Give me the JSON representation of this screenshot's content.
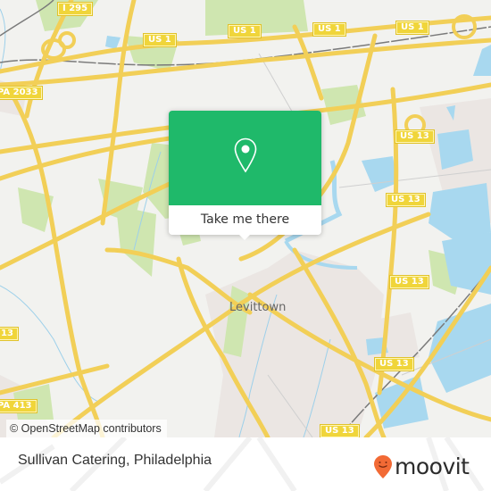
{
  "map": {
    "place_label": "Levittown",
    "shields": [
      {
        "id": "i295",
        "label": "I 295"
      },
      {
        "id": "us1-a",
        "label": "US 1"
      },
      {
        "id": "us1-b",
        "label": "US 1"
      },
      {
        "id": "us1-c",
        "label": "US 1"
      },
      {
        "id": "us1-d",
        "label": "US 1"
      },
      {
        "id": "us1-e",
        "label": "US 1"
      },
      {
        "id": "pa2033",
        "label": "PA 2033"
      },
      {
        "id": "us13-a",
        "label": "US 13"
      },
      {
        "id": "us13-b",
        "label": "US 13"
      },
      {
        "id": "us13-c",
        "label": "US 13"
      },
      {
        "id": "us13-d",
        "label": "US 13"
      },
      {
        "id": "us13-e",
        "label": "US 13"
      },
      {
        "id": "us13-f",
        "label": "13"
      },
      {
        "id": "pa413",
        "label": "PA 413"
      }
    ],
    "colors": {
      "background": "#f2f2ef",
      "road": "#f7df6b",
      "water": "#a8d8ef",
      "park": "#cfe6b0",
      "residential": "#ebe6e3",
      "rail": "#7a7a7a"
    }
  },
  "popup": {
    "icon": "location-pin-icon",
    "button_label": "Take me there",
    "color": "#1fb96a"
  },
  "attribution": "© OpenStreetMap contributors",
  "footer": {
    "title": "Sullivan Catering, Philadelphia",
    "brand": "moovit",
    "brand_color": "#f26a35"
  }
}
